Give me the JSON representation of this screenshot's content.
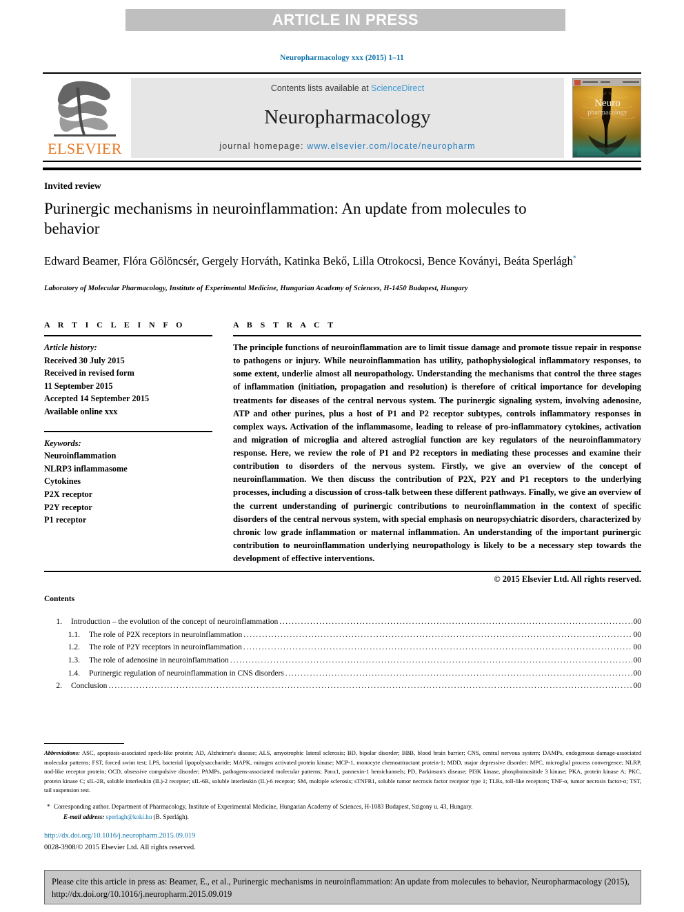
{
  "banner": {
    "text": "ARTICLE IN PRESS"
  },
  "running_head": {
    "text": "Neuropharmacology xxx (2015) 1–11"
  },
  "masthead": {
    "contents_prefix": "Contents lists available at ",
    "sciencedirect": "ScienceDirect",
    "journal_name": "Neuropharmacology",
    "homepage_prefix": "journal homepage: ",
    "homepage_url": "www.elsevier.com/locate/neuropharm",
    "publisher_logo_word": "ELSEVIER",
    "cover_title_line1": "Neuro",
    "cover_title_line2": "pharmacology"
  },
  "article": {
    "type": "Invited review",
    "title": "Purinergic mechanisms in neuroinflammation: An update from molecules to behavior",
    "authors": "Edward Beamer, Flóra Gölöncsér, Gergely Horváth, Katinka Bekő, Lilla Otrokocsi, Bence Koványi, Beáta Sperlágh",
    "author_marker": "*",
    "affiliation": "Laboratory of Molecular Pharmacology, Institute of Experimental Medicine, Hungarian Academy of Sciences, H-1450 Budapest, Hungary"
  },
  "info": {
    "heading": "A R T I C L E  I N F O",
    "history_label": "Article history:",
    "history_lines": [
      "Received 30 July 2015",
      "Received in revised form",
      "11 September 2015",
      "Accepted 14 September 2015",
      "Available online xxx"
    ],
    "keywords_label": "Keywords:",
    "keywords": [
      "Neuroinflammation",
      "NLRP3 inflammasome",
      "Cytokines",
      "P2X receptor",
      "P2Y receptor",
      "P1 receptor"
    ]
  },
  "abstract": {
    "heading": "A B S T R A C T",
    "body": "The principle functions of neuroinflammation are to limit tissue damage and promote tissue repair in response to pathogens or injury. While neuroinflammation has utility, pathophysiological inflammatory responses, to some extent, underlie almost all neuropathology. Understanding the mechanisms that control the three stages of inflammation (initiation, propagation and resolution) is therefore of critical importance for developing treatments for diseases of the central nervous system. The purinergic signaling system, involving adenosine, ATP and other purines, plus a host of P1 and P2 receptor subtypes, controls inflammatory responses in complex ways. Activation of the inflammasome, leading to release of pro-inflammatory cytokines, activation and migration of microglia and altered astroglial function are key regulators of the neuroinflammatory response. Here, we review the role of P1 and P2 receptors in mediating these processes and examine their contribution to disorders of the nervous system. Firstly, we give an overview of the concept of neuroinflammation. We then discuss the contribution of P2X, P2Y and P1 receptors to the underlying processes, including a discussion of cross-talk between these different pathways. Finally, we give an overview of the current understanding of purinergic contributions to neuroinflammation in the context of specific disorders of the central nervous system, with special emphasis on neuropsychiatric disorders, characterized by chronic low grade inflammation or maternal inflammation. An understanding of the important purinergic contribution to neuroinflammation underlying neuropathology is likely to be a necessary step towards the development of effective interventions.",
    "copyright": "© 2015 Elsevier Ltd. All rights reserved."
  },
  "contents": {
    "heading": "Contents",
    "entries": [
      {
        "number": "1.",
        "label": "Introduction – the evolution of the concept of neuroinflammation",
        "page": "00",
        "sub": false
      },
      {
        "number": "1.1.",
        "label": "The role of P2X receptors in neuroinflammation",
        "page": "00",
        "sub": true
      },
      {
        "number": "1.2.",
        "label": "The role of P2Y receptors in neuroinflammation",
        "page": "00",
        "sub": true
      },
      {
        "number": "1.3.",
        "label": "The role of adenosine in neuroinflammation",
        "page": "00",
        "sub": true
      },
      {
        "number": "1.4.",
        "label": "Purinergic regulation of neuroinflammation in CNS disorders",
        "page": "00",
        "sub": true
      },
      {
        "number": "2.",
        "label": "Conclusion",
        "page": "00",
        "sub": false
      }
    ],
    "dot_leader": "................................................................................................................................................................................................................."
  },
  "footnotes": {
    "abbrev_label": "Abbreviations:",
    "abbrev_text": " ASC, apoptosis-associated speck-like protein; AD, Alzheimer's disease; ALS, amyotrophic lateral sclerosis; BD, bipolar disorder; BBB, blood brain barrier; CNS, central nervous system; DAMPs, endogenous damage-associated molecular patterns; FST, forced swim test; LPS, bacterial lipopolysaccharide; MAPK, mitogen activated protein kinase; MCP-1, monocyte chemoattractant protein-1; MDD, major depressive disorder; MPC, microglial process convergence; NLRP, nod-like receptor protein; OCD, obsessive compulsive disorder; PAMPs, pathogens-associated molecular patterns; Panx1, pannexin-1 hemichannels; PD, Parkinson's disease; PI3K kinase, phosphoinositide 3 kinase; PKA, protein kinase A; PKC, protein kinase C; sIL-2R, soluble interleukin (IL)-2 receptor; sIL-6R, soluble interleukin (IL)-6 receptor; SM, multiple sclerosis; sTNFR1, soluble tumor necrosis factor receptor type 1; TLRs, toll-like receptors; TNF-α, tumor necrosis factor-α; TST, tail suspension test.",
    "corresp_star": "*",
    "corresp_text": "Corresponding author. Department of Pharmacology, Institute of Experimental Medicine, Hungarian Academy of Sciences, H-1083 Budapest, Szigony u. 43, Hungary.",
    "email_label": "E-mail address:",
    "email": "sperlagh@koki.hu",
    "email_suffix": " (B. Sperlágh).",
    "doi": "http://dx.doi.org/10.1016/j.neuropharm.2015.09.019",
    "issn": "0028-3908/© 2015 Elsevier Ltd. All rights reserved."
  },
  "cite_box": {
    "text": "Please cite this article in press as: Beamer, E., et al., Purinergic mechanisms in neuroinflammation: An update from molecules to behavior, Neuropharmacology (2015), http://dx.doi.org/10.1016/j.neuropharm.2015.09.019"
  },
  "colors": {
    "link_blue": "#1175ab",
    "sciencedirect_blue": "#3c9bd4",
    "elsevier_orange": "#e87722",
    "banner_grey": "#bfbfbf",
    "panel_grey": "#e6e6e6",
    "cite_box_grey": "#c8c8c8"
  }
}
